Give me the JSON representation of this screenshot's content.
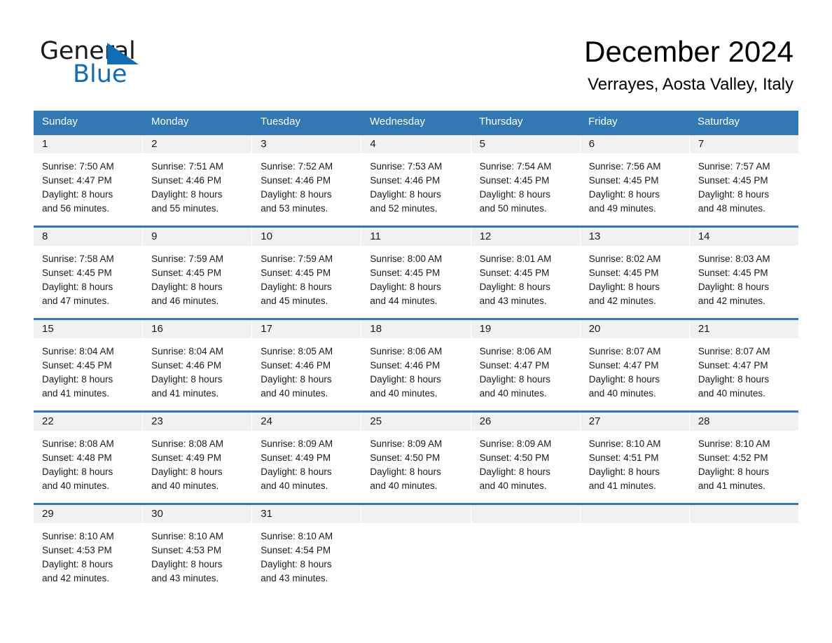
{
  "brand": {
    "name_part1": "General",
    "name_part2": "Blue",
    "accent_color": "#0f6cb5",
    "triangle_icon": "triangle-icon"
  },
  "header": {
    "title": "December 2024",
    "location": "Verrayes, Aosta Valley, Italy"
  },
  "calendar": {
    "header_color": "#3178b4",
    "weekdays": [
      "Sunday",
      "Monday",
      "Tuesday",
      "Wednesday",
      "Thursday",
      "Friday",
      "Saturday"
    ],
    "weeks": [
      [
        {
          "day": "1",
          "sunrise": "Sunrise: 7:50 AM",
          "sunset": "Sunset: 4:47 PM",
          "daylight_line1": "Daylight: 8 hours",
          "daylight_line2": "and 56 minutes."
        },
        {
          "day": "2",
          "sunrise": "Sunrise: 7:51 AM",
          "sunset": "Sunset: 4:46 PM",
          "daylight_line1": "Daylight: 8 hours",
          "daylight_line2": "and 55 minutes."
        },
        {
          "day": "3",
          "sunrise": "Sunrise: 7:52 AM",
          "sunset": "Sunset: 4:46 PM",
          "daylight_line1": "Daylight: 8 hours",
          "daylight_line2": "and 53 minutes."
        },
        {
          "day": "4",
          "sunrise": "Sunrise: 7:53 AM",
          "sunset": "Sunset: 4:46 PM",
          "daylight_line1": "Daylight: 8 hours",
          "daylight_line2": "and 52 minutes."
        },
        {
          "day": "5",
          "sunrise": "Sunrise: 7:54 AM",
          "sunset": "Sunset: 4:45 PM",
          "daylight_line1": "Daylight: 8 hours",
          "daylight_line2": "and 50 minutes."
        },
        {
          "day": "6",
          "sunrise": "Sunrise: 7:56 AM",
          "sunset": "Sunset: 4:45 PM",
          "daylight_line1": "Daylight: 8 hours",
          "daylight_line2": "and 49 minutes."
        },
        {
          "day": "7",
          "sunrise": "Sunrise: 7:57 AM",
          "sunset": "Sunset: 4:45 PM",
          "daylight_line1": "Daylight: 8 hours",
          "daylight_line2": "and 48 minutes."
        }
      ],
      [
        {
          "day": "8",
          "sunrise": "Sunrise: 7:58 AM",
          "sunset": "Sunset: 4:45 PM",
          "daylight_line1": "Daylight: 8 hours",
          "daylight_line2": "and 47 minutes."
        },
        {
          "day": "9",
          "sunrise": "Sunrise: 7:59 AM",
          "sunset": "Sunset: 4:45 PM",
          "daylight_line1": "Daylight: 8 hours",
          "daylight_line2": "and 46 minutes."
        },
        {
          "day": "10",
          "sunrise": "Sunrise: 7:59 AM",
          "sunset": "Sunset: 4:45 PM",
          "daylight_line1": "Daylight: 8 hours",
          "daylight_line2": "and 45 minutes."
        },
        {
          "day": "11",
          "sunrise": "Sunrise: 8:00 AM",
          "sunset": "Sunset: 4:45 PM",
          "daylight_line1": "Daylight: 8 hours",
          "daylight_line2": "and 44 minutes."
        },
        {
          "day": "12",
          "sunrise": "Sunrise: 8:01 AM",
          "sunset": "Sunset: 4:45 PM",
          "daylight_line1": "Daylight: 8 hours",
          "daylight_line2": "and 43 minutes."
        },
        {
          "day": "13",
          "sunrise": "Sunrise: 8:02 AM",
          "sunset": "Sunset: 4:45 PM",
          "daylight_line1": "Daylight: 8 hours",
          "daylight_line2": "and 42 minutes."
        },
        {
          "day": "14",
          "sunrise": "Sunrise: 8:03 AM",
          "sunset": "Sunset: 4:45 PM",
          "daylight_line1": "Daylight: 8 hours",
          "daylight_line2": "and 42 minutes."
        }
      ],
      [
        {
          "day": "15",
          "sunrise": "Sunrise: 8:04 AM",
          "sunset": "Sunset: 4:45 PM",
          "daylight_line1": "Daylight: 8 hours",
          "daylight_line2": "and 41 minutes."
        },
        {
          "day": "16",
          "sunrise": "Sunrise: 8:04 AM",
          "sunset": "Sunset: 4:46 PM",
          "daylight_line1": "Daylight: 8 hours",
          "daylight_line2": "and 41 minutes."
        },
        {
          "day": "17",
          "sunrise": "Sunrise: 8:05 AM",
          "sunset": "Sunset: 4:46 PM",
          "daylight_line1": "Daylight: 8 hours",
          "daylight_line2": "and 40 minutes."
        },
        {
          "day": "18",
          "sunrise": "Sunrise: 8:06 AM",
          "sunset": "Sunset: 4:46 PM",
          "daylight_line1": "Daylight: 8 hours",
          "daylight_line2": "and 40 minutes."
        },
        {
          "day": "19",
          "sunrise": "Sunrise: 8:06 AM",
          "sunset": "Sunset: 4:47 PM",
          "daylight_line1": "Daylight: 8 hours",
          "daylight_line2": "and 40 minutes."
        },
        {
          "day": "20",
          "sunrise": "Sunrise: 8:07 AM",
          "sunset": "Sunset: 4:47 PM",
          "daylight_line1": "Daylight: 8 hours",
          "daylight_line2": "and 40 minutes."
        },
        {
          "day": "21",
          "sunrise": "Sunrise: 8:07 AM",
          "sunset": "Sunset: 4:47 PM",
          "daylight_line1": "Daylight: 8 hours",
          "daylight_line2": "and 40 minutes."
        }
      ],
      [
        {
          "day": "22",
          "sunrise": "Sunrise: 8:08 AM",
          "sunset": "Sunset: 4:48 PM",
          "daylight_line1": "Daylight: 8 hours",
          "daylight_line2": "and 40 minutes."
        },
        {
          "day": "23",
          "sunrise": "Sunrise: 8:08 AM",
          "sunset": "Sunset: 4:49 PM",
          "daylight_line1": "Daylight: 8 hours",
          "daylight_line2": "and 40 minutes."
        },
        {
          "day": "24",
          "sunrise": "Sunrise: 8:09 AM",
          "sunset": "Sunset: 4:49 PM",
          "daylight_line1": "Daylight: 8 hours",
          "daylight_line2": "and 40 minutes."
        },
        {
          "day": "25",
          "sunrise": "Sunrise: 8:09 AM",
          "sunset": "Sunset: 4:50 PM",
          "daylight_line1": "Daylight: 8 hours",
          "daylight_line2": "and 40 minutes."
        },
        {
          "day": "26",
          "sunrise": "Sunrise: 8:09 AM",
          "sunset": "Sunset: 4:50 PM",
          "daylight_line1": "Daylight: 8 hours",
          "daylight_line2": "and 40 minutes."
        },
        {
          "day": "27",
          "sunrise": "Sunrise: 8:10 AM",
          "sunset": "Sunset: 4:51 PM",
          "daylight_line1": "Daylight: 8 hours",
          "daylight_line2": "and 41 minutes."
        },
        {
          "day": "28",
          "sunrise": "Sunrise: 8:10 AM",
          "sunset": "Sunset: 4:52 PM",
          "daylight_line1": "Daylight: 8 hours",
          "daylight_line2": "and 41 minutes."
        }
      ],
      [
        {
          "day": "29",
          "sunrise": "Sunrise: 8:10 AM",
          "sunset": "Sunset: 4:53 PM",
          "daylight_line1": "Daylight: 8 hours",
          "daylight_line2": "and 42 minutes."
        },
        {
          "day": "30",
          "sunrise": "Sunrise: 8:10 AM",
          "sunset": "Sunset: 4:53 PM",
          "daylight_line1": "Daylight: 8 hours",
          "daylight_line2": "and 43 minutes."
        },
        {
          "day": "31",
          "sunrise": "Sunrise: 8:10 AM",
          "sunset": "Sunset: 4:54 PM",
          "daylight_line1": "Daylight: 8 hours",
          "daylight_line2": "and 43 minutes."
        },
        {
          "day": "",
          "sunrise": "",
          "sunset": "",
          "daylight_line1": "",
          "daylight_line2": ""
        },
        {
          "day": "",
          "sunrise": "",
          "sunset": "",
          "daylight_line1": "",
          "daylight_line2": ""
        },
        {
          "day": "",
          "sunrise": "",
          "sunset": "",
          "daylight_line1": "",
          "daylight_line2": ""
        },
        {
          "day": "",
          "sunrise": "",
          "sunset": "",
          "daylight_line1": "",
          "daylight_line2": ""
        }
      ]
    ]
  }
}
